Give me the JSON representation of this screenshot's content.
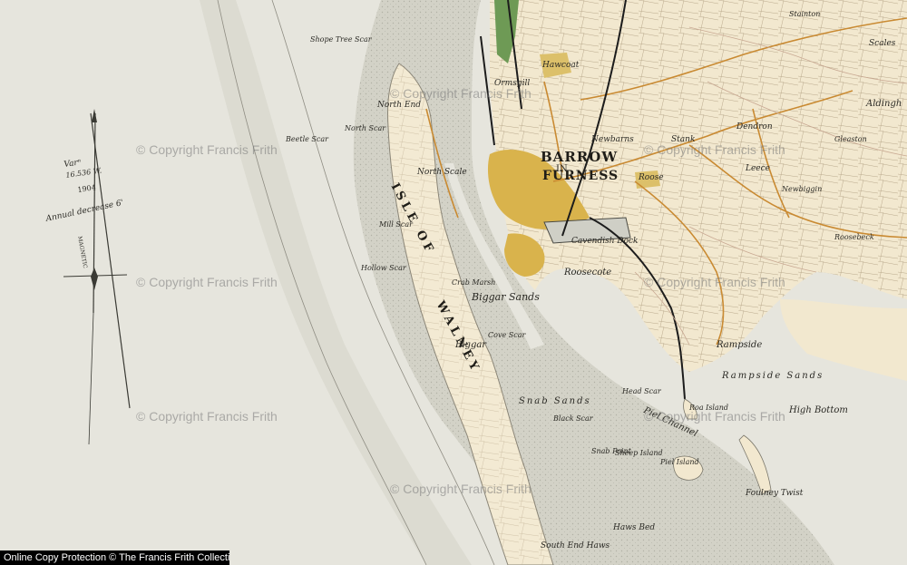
{
  "map": {
    "footer": "Online Copy Protection © The Francis Frith Collection",
    "watermark": "© Copyright Francis Frith",
    "colors": {
      "sea": "#e6e5dd",
      "sand": "#d2d1c6",
      "land": "#f3ead2",
      "town": "#d8b24a",
      "road": "#c98a32",
      "rail": "#1c1c1c",
      "contour": "#c8a892",
      "woods": "#5f8c4a"
    },
    "labels": {
      "barrow": "BARROW",
      "in": "IN",
      "furness": "FURNESS",
      "isle_of": "ISLE OF",
      "walney": "WALNEY",
      "cavendish_dock": "Cavendish Dock",
      "roosecote": "Roosecote",
      "roose": "Roose",
      "biggar": "Biggar",
      "biggar_sands": "Biggar Sands",
      "north_end": "North End",
      "north_scale": "North Scale",
      "north_scar": "North Scar",
      "ormsgill": "Ormsgill",
      "hawcoat": "Hawcoat",
      "newbarns": "Newbarns",
      "rampside": "Rampside",
      "rampside_sands": "Rampside Sands",
      "high_bottom": "High Bottom",
      "piel_channel": "Piel Channel",
      "roa_island": "Roa Island",
      "piel_island": "Piel Island",
      "foulney_twist": "Foulney Twist",
      "south_end_haws": "South End Haws",
      "haws_bed": "Haws Bed",
      "snab_sands": "Snab Sands",
      "roosebeck": "Roosebeck",
      "newbiggin": "Newbiggin",
      "aldingham": "Aldingh",
      "leece": "Leece",
      "dendron": "Dendron",
      "stank": "Stank",
      "gleaston": "Gleaston",
      "stainton": "Stainton",
      "scales": "Scales",
      "var": "Varⁿ",
      "var_value": "16.536 W.",
      "year": "1904",
      "annual": "Annual decrease 6'",
      "magnetic": "MAGNETIC",
      "shope_tree_scar": "Shope Tree Scar",
      "beetle_scar": "Beetle Scar",
      "hollow_scar": "Hollow Scar",
      "mill_scar": "Mill Scar",
      "cove_scar": "Cove Scar",
      "head_scar": "Head Scar",
      "black_scar": "Black Scar",
      "sheep_island": "Sheep Island",
      "snab_point": "Snab Point",
      "crab_marsh": "Crab Marsh"
    }
  }
}
